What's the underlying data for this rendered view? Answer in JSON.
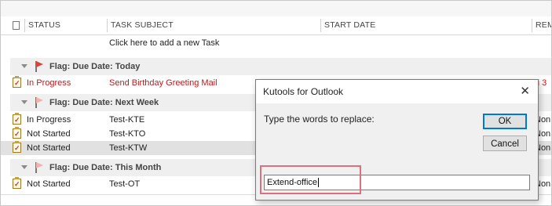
{
  "columns": {
    "status": "STATUS",
    "subject": "TASK SUBJECT",
    "start_date": "START DATE",
    "reminder_partial": "REM"
  },
  "add_task_prompt": "Click here to add a new Task",
  "groups": [
    {
      "label": "Flag: Due Date: Today",
      "flag_color": "#d9453b",
      "rows": [
        {
          "status": "In Progress",
          "subject": "Send Birthday Greeting Mail",
          "reminder": "ri 3",
          "color": "#c0181b"
        }
      ]
    },
    {
      "label": "Flag: Due Date: Next Week",
      "flag_color": "#f2b3ae",
      "rows": [
        {
          "status": "In Progress",
          "subject": "Test-KTE",
          "reminder": "Non"
        },
        {
          "status": "Not Started",
          "subject": "Test-KTO",
          "reminder": "Non"
        },
        {
          "status": "Not Started",
          "subject": "Test-KTW",
          "reminder": "Non",
          "selected": true
        }
      ]
    },
    {
      "label": "Flag: Due Date: This Month",
      "flag_color": "#f2b3ae",
      "rows": [
        {
          "status": "Not Started",
          "subject": "Test-OT",
          "reminder": "Non"
        }
      ]
    }
  ],
  "dialog": {
    "title": "Kutools for Outlook",
    "close_glyph": "✕",
    "prompt": "Type the words to replace:",
    "ok_label": "OK",
    "cancel_label": "Cancel",
    "input_value": "Extend-office"
  },
  "colors": {
    "dialog_border": "#18a1a6",
    "highlight_border": "#de6f7d",
    "overdue_text": "#c0181b"
  }
}
